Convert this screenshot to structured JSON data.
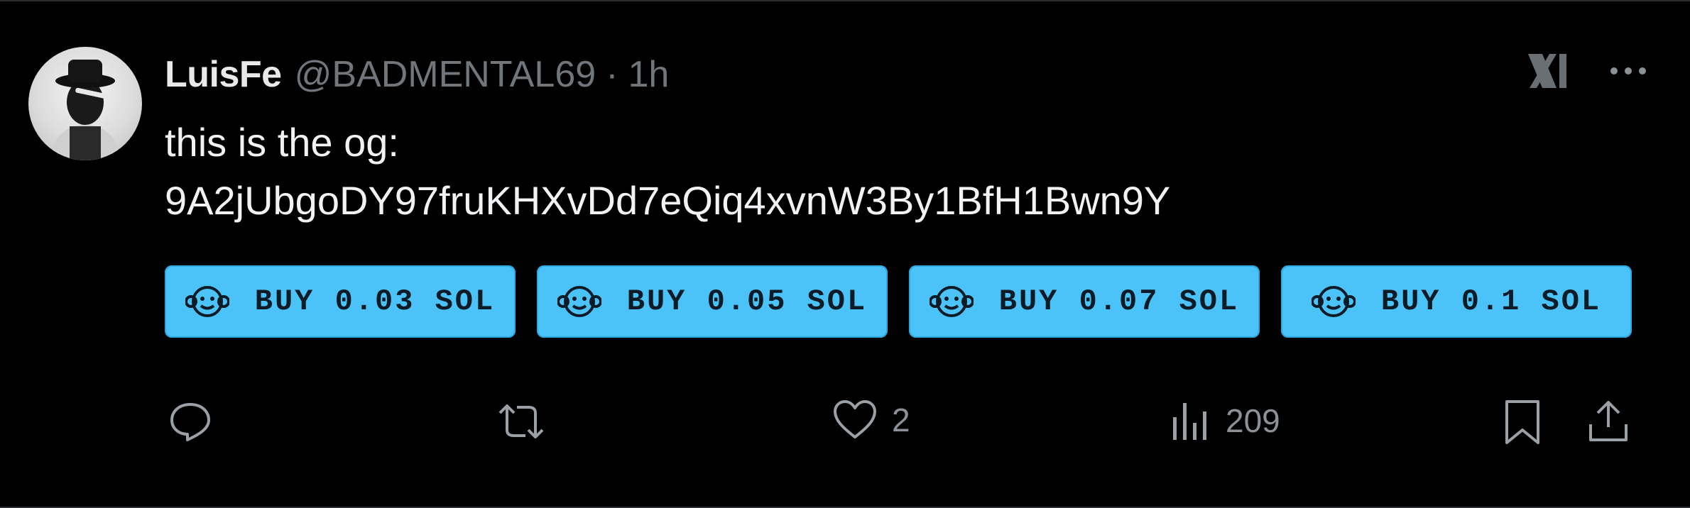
{
  "tweet": {
    "author_name": "LuisFe",
    "handle": "@BADMENTAL69",
    "separator": "·",
    "time": "1h",
    "text_line1": "this is the og:",
    "text_line2": "9A2jUbgoDY97fruKHXvDd7eQiq4xvnW3By1BfH1Bwn9Y"
  },
  "buy_buttons": [
    {
      "label": "BUY 0.03 SOL",
      "icon": "monkey-icon"
    },
    {
      "label": "BUY 0.05 SOL",
      "icon": "monkey-icon"
    },
    {
      "label": "BUY 0.07 SOL",
      "icon": "monkey-icon"
    },
    {
      "label": "BUY 0.1 SOL",
      "icon": "monkey-icon"
    }
  ],
  "actions": {
    "reply_icon": "reply-icon",
    "retweet_icon": "retweet-icon",
    "like_icon": "heart-icon",
    "like_count": "2",
    "views_icon": "views-icon",
    "view_count": "209",
    "bookmark_icon": "bookmark-icon",
    "share_icon": "share-icon"
  },
  "colors": {
    "background": "#000000",
    "button": "#4cc3f8",
    "muted": "#71767b",
    "text": "#e7e9ea"
  }
}
